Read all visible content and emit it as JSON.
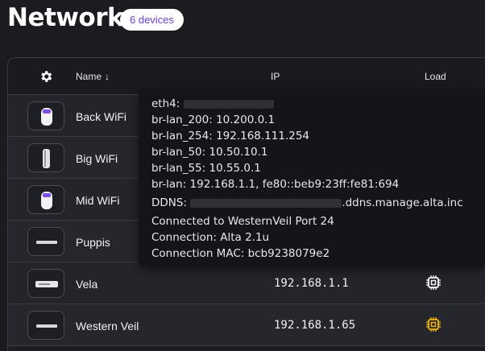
{
  "header": {
    "title": "Network",
    "device_count_label": "6 devices"
  },
  "table": {
    "columns": {
      "name": "Name",
      "sort_arrow": "↓",
      "ip": "IP",
      "load": "Load"
    },
    "rows": [
      {
        "name": "Back WiFi",
        "ip": "",
        "icon": "wifi-ap-pro-icon"
      },
      {
        "name": "Big WiFi",
        "ip": "",
        "icon": "wifi-panel-icon"
      },
      {
        "name": "Mid WiFi",
        "ip": "",
        "icon": "wifi-ap-pro-icon"
      },
      {
        "name": "Puppis",
        "ip": "",
        "icon": "switch-icon"
      },
      {
        "name": "Vela",
        "ip": "192.168.1.1",
        "icon": "router-icon"
      },
      {
        "name": "Western Veil",
        "ip": "192.168.1.65",
        "icon": "switch-icon"
      }
    ]
  },
  "tooltip": {
    "eth4_label": "eth4:",
    "lines": [
      "br-lan_200: 10.200.0.1",
      "br-lan_254: 192.168.111.254",
      "br-lan_50: 10.50.10.1",
      "br-lan_55: 10.55.0.1",
      "br-lan: 192.168.1.1, fe80::beb9:23ff:fe81:694"
    ],
    "ddns_label": "DDNS:",
    "ddns_suffix": ".ddns.manage.alta.inc",
    "connected_to": "Connected to WesternVeil Port 24",
    "connection": "Connection: Alta 2.1u",
    "connection_mac": "Connection MAC: bcb9238079e2"
  },
  "colors": {
    "accent": "#6c3df0",
    "load_normal": "#ffffff",
    "load_warning": "#f5b800"
  }
}
